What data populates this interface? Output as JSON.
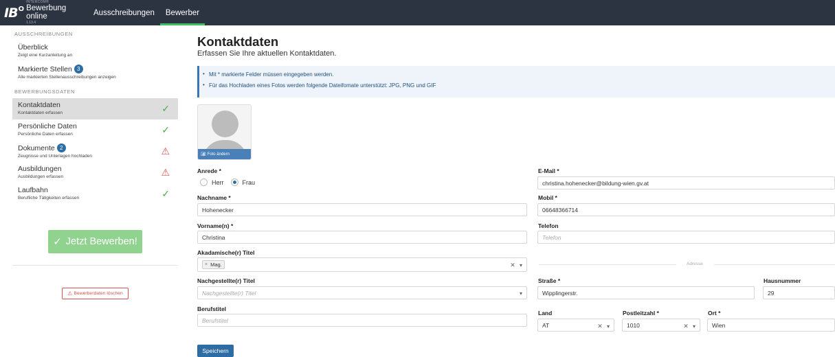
{
  "topbar": {
    "logo_text": "IB",
    "logo_sup": "O",
    "brand_small": "INTERCOM®",
    "brand_name": "Bewerbung online",
    "brand_version": "1.13.4",
    "nav": [
      {
        "label": "Ausschreibungen",
        "active": false
      },
      {
        "label": "Bewerber",
        "active": true
      }
    ]
  },
  "sidebar": {
    "section_ausschreibungen": "AUSSCHREIBUNGEN",
    "ueberblick": {
      "title": "Überblick",
      "sub": "Zeigt eine Kurzanleitung an"
    },
    "markierte": {
      "title": "Markierte Stellen",
      "badge": "3",
      "sub": "Alle markierten Stellenausschreibungen anzeigen"
    },
    "section_bewerbungsdaten": "BEWERBUNGSDATEN",
    "items": [
      {
        "title": "Kontaktdaten",
        "sub": "Kontaktdaten erfassen",
        "status": "ok",
        "badge": ""
      },
      {
        "title": "Persönliche Daten",
        "sub": "Persönliche Daten erfassen",
        "status": "ok",
        "badge": ""
      },
      {
        "title": "Dokumente",
        "sub": "Zeugnisse und Unterlagen hochladen",
        "status": "warn",
        "badge": "2"
      },
      {
        "title": "Ausbildungen",
        "sub": "Ausbildungen erfassen",
        "status": "warn",
        "badge": ""
      },
      {
        "title": "Laufbahn",
        "sub": "Berufliche Tätigkeiten erfassen",
        "status": "ok",
        "badge": ""
      }
    ],
    "apply_button": "Jetzt Bewerben!",
    "delete_button": "Bewerberdaten löschen"
  },
  "main": {
    "title": "Kontaktdaten",
    "subtitle": "Erfassen Sie Ihre aktuellen Kontaktdaten.",
    "info": [
      "Mit * markierte Felder müssen eingegeben werden.",
      "Für das Hochladen eines Fotos werden folgende Dateifomate unterstützt: JPG, PNG und GIF"
    ],
    "photo_change": "Foto ändern",
    "anrede": {
      "label": "Anrede *",
      "options": [
        "Herr",
        "Frau"
      ],
      "selected": "Frau"
    },
    "nachname": {
      "label": "Nachname *",
      "value": "Hohenecker"
    },
    "vorname": {
      "label": "Vorname(n) *",
      "value": "Christina"
    },
    "akad_titel": {
      "label": "Akadamische(r) Titel",
      "tag": "Mag."
    },
    "nach_titel": {
      "label": "Nachgestellte(r) Titel",
      "placeholder": "Nachgestellte(r) Titel"
    },
    "berufstitel": {
      "label": "Berufstitel",
      "placeholder": "Berufstitel"
    },
    "email": {
      "label": "E-Mail *",
      "value": "christina.hohenecker@bildung-wien.gv.at"
    },
    "mobil": {
      "label": "Mobil *",
      "value": "06648366714"
    },
    "telefon": {
      "label": "Telefon",
      "placeholder": "Telefon"
    },
    "adresse_divider": "Adresse",
    "strasse": {
      "label": "Straße *",
      "value": "Wipplingerstr."
    },
    "hausnummer": {
      "label": "Hausnummer",
      "value": "29"
    },
    "land": {
      "label": "Land",
      "value": "AT"
    },
    "plz": {
      "label": "Postleitzahl *",
      "value": "1010"
    },
    "ort": {
      "label": "Ort *",
      "value": "Wien"
    },
    "save_button": "Speichern"
  },
  "colors": {
    "topbar": "#2b3440",
    "accent_blue": "#2e6da4",
    "ok_green": "#4cae4c",
    "warn_red": "#d9534f",
    "apply_green": "#8fd38f"
  }
}
